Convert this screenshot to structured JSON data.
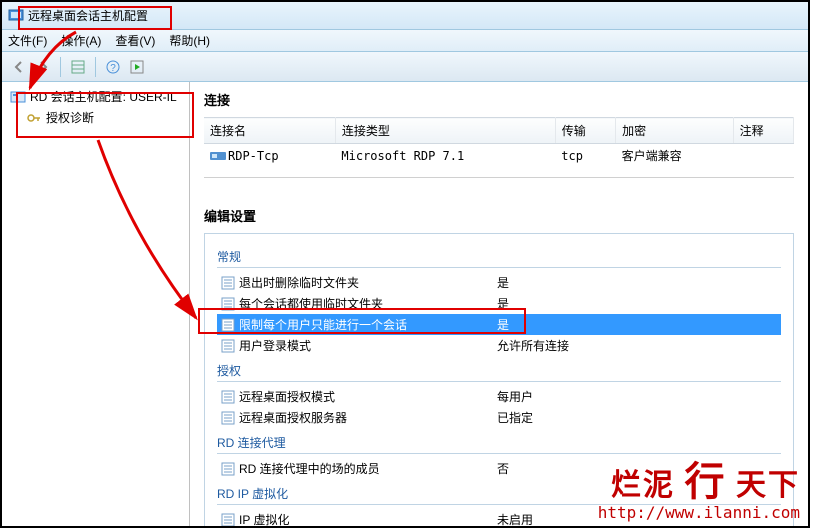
{
  "title": "远程桌面会话主机配置",
  "menus": {
    "file": "文件(F)",
    "action": "操作(A)",
    "view": "查看(V)",
    "help": "帮助(H)"
  },
  "tree": {
    "root": "RD 会话主机配置: USER-IL",
    "child": "授权诊断"
  },
  "connections": {
    "title": "连接",
    "headers": {
      "name": "连接名",
      "type": "连接类型",
      "transport": "传输",
      "encryption": "加密",
      "comment": "注释"
    },
    "rows": [
      {
        "name": "RDP-Tcp",
        "type": "Microsoft RDP 7.1",
        "transport": "tcp",
        "encryption": "客户端兼容",
        "comment": ""
      }
    ]
  },
  "editSettings": {
    "title": "编辑设置",
    "groups": [
      {
        "name": "常规",
        "items": [
          {
            "label": "退出时删除临时文件夹",
            "value": "是"
          },
          {
            "label": "每个会话都使用临时文件夹",
            "value": "是"
          },
          {
            "label": "限制每个用户只能进行一个会话",
            "value": "是",
            "selected": true
          },
          {
            "label": "用户登录模式",
            "value": "允许所有连接"
          }
        ]
      },
      {
        "name": "授权",
        "items": [
          {
            "label": "远程桌面授权模式",
            "value": "每用户"
          },
          {
            "label": "远程桌面授权服务器",
            "value": "已指定"
          }
        ]
      },
      {
        "name": "RD 连接代理",
        "items": [
          {
            "label": "RD 连接代理中的场的成员",
            "value": "否"
          }
        ]
      },
      {
        "name": "RD IP 虚拟化",
        "items": [
          {
            "label": "IP 虚拟化",
            "value": "未启用"
          }
        ]
      }
    ]
  },
  "watermark": {
    "text1": "烂泥",
    "text2": "行",
    "text3": "天下",
    "url": "http://www.ilanni.com"
  }
}
